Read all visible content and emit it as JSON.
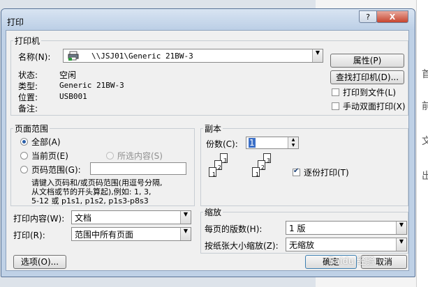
{
  "dialog": {
    "title": "打印",
    "help_label": "?",
    "close_label": "X"
  },
  "printer": {
    "group_title": "打印机",
    "name_label": "名称(N):",
    "name_value": "\\\\JSJ01\\Generic 21BW-3",
    "status_label": "状态:",
    "status_value": "空闲",
    "type_label": "类型:",
    "type_value": "Generic 21BW-3",
    "location_label": "位置:",
    "location_value": "USB001",
    "comment_label": "备注:",
    "properties_button": "属性(P)",
    "find_printer_button": "查找打印机(D)...",
    "print_to_file_label": "打印到文件(L)",
    "print_to_file_checked": false,
    "manual_duplex_label": "手动双面打印(X)",
    "manual_duplex_checked": false
  },
  "page_range": {
    "group_title": "页面范围",
    "all_label": "全部(A)",
    "current_label": "当前页(E)",
    "selection_label": "所选内容(S)",
    "pages_label": "页码范围(G):",
    "pages_value": "",
    "selected": "all",
    "hint_line1": "请键入页码和/或页码范围(用逗号分隔,",
    "hint_line2": "从文档或节的开头算起),例如: 1, 3,",
    "hint_line3": "5-12 或 p1s1, p1s2, p1s3-p8s3"
  },
  "copies": {
    "group_title": "副本",
    "count_label": "份数(C):",
    "count_value": "1",
    "collate_label": "逐份打印(T)",
    "collate_checked": true,
    "page_numbers": [
      "1",
      "2",
      "3"
    ]
  },
  "print_what": {
    "label": "打印内容(W):",
    "value": "文档"
  },
  "print_option": {
    "label": "打印(R):",
    "value": "范围中所有页面"
  },
  "zoom": {
    "group_title": "缩放",
    "pages_per_sheet_label": "每页的版数(H):",
    "pages_per_sheet_value": "1 版",
    "scale_to_paper_label": "按纸张大小缩放(Z):",
    "scale_to_paper_value": "无缩放"
  },
  "buttons": {
    "options": "选项(O)...",
    "ok": "确定",
    "cancel": "取消"
  },
  "background": {
    "side_chars": [
      "首",
      "前",
      "文",
      "出"
    ]
  },
  "watermark": "Baidu 经验"
}
